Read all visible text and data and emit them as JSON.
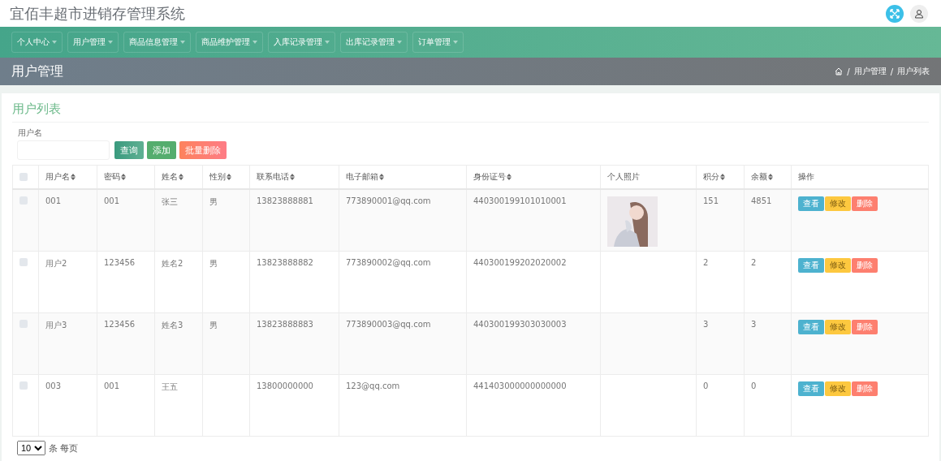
{
  "app_title": "宜佰丰超市进销存管理系统",
  "nav": [
    {
      "label": "个人中心"
    },
    {
      "label": "用户管理"
    },
    {
      "label": "商品信息管理"
    },
    {
      "label": "商品维护管理"
    },
    {
      "label": "入库记录管理"
    },
    {
      "label": "出库记录管理"
    },
    {
      "label": "订单管理"
    }
  ],
  "page_title": "用户管理",
  "breadcrumb": [
    {
      "separator": "/",
      "label": "用户管理"
    },
    {
      "separator": "/",
      "label": "用户列表"
    }
  ],
  "card_title": "用户列表",
  "search": {
    "label": "用户名",
    "buttons": [
      {
        "label": "查询",
        "kind": "query"
      },
      {
        "label": "添加",
        "kind": "add"
      },
      {
        "label": "批量删除",
        "kind": "delete"
      }
    ]
  },
  "table": {
    "select_all": {
      "checked": false
    },
    "columns": [
      {
        "label": "用户名",
        "kind": "sortable"
      },
      {
        "label": "密码",
        "kind": "sortable"
      },
      {
        "label": "姓名",
        "kind": "sortable"
      },
      {
        "label": "性别",
        "kind": "sortable"
      },
      {
        "label": "联系电话",
        "kind": "sortable"
      },
      {
        "label": "电子邮箱",
        "kind": "sortable"
      },
      {
        "label": "身份证号",
        "kind": "sortable"
      },
      {
        "label": "个人照片",
        "kind": "plain"
      },
      {
        "label": "积分",
        "kind": "sortable"
      },
      {
        "label": "余额",
        "kind": "sortable"
      },
      {
        "label": "操作",
        "kind": "plain"
      }
    ],
    "rows": [
      {
        "checked": false,
        "cells": [
          "001",
          "001",
          "张三",
          "男",
          "13823888881",
          "773890001@qq.com",
          "440300199101010001",
          {
            "kind": "picture"
          },
          "151",
          "4851"
        ],
        "actions": [
          {
            "label": "查看",
            "kind": "view"
          },
          {
            "label": "修改",
            "kind": "edit"
          },
          {
            "label": "删除",
            "kind": "delete"
          }
        ]
      },
      {
        "checked": false,
        "cells": [
          "用户2",
          "123456",
          "姓名2",
          "男",
          "13823888882",
          "773890002@qq.com",
          "440300199202020002",
          null,
          "2",
          "2"
        ],
        "actions": [
          {
            "label": "查看",
            "kind": "view"
          },
          {
            "label": "修改",
            "kind": "edit"
          },
          {
            "label": "删除",
            "kind": "delete"
          }
        ]
      },
      {
        "checked": false,
        "cells": [
          "用户3",
          "123456",
          "姓名3",
          "男",
          "13823888883",
          "773890003@qq.com",
          "440300199303030003",
          null,
          "3",
          "3"
        ],
        "actions": [
          {
            "label": "查看",
            "kind": "view"
          },
          {
            "label": "修改",
            "kind": "edit"
          },
          {
            "label": "删除",
            "kind": "delete"
          }
        ]
      },
      {
        "checked": false,
        "cells": [
          "003",
          "001",
          "王五",
          null,
          "13800000000",
          "123@qq.com",
          "441403000000000000",
          null,
          "0",
          "0"
        ],
        "actions": [
          {
            "label": "查看",
            "kind": "view"
          },
          {
            "label": "修改",
            "kind": "edit"
          },
          {
            "label": "删除",
            "kind": "delete"
          }
        ]
      }
    ]
  },
  "pagination": {
    "page_size": "10",
    "label": "条 每页"
  }
}
